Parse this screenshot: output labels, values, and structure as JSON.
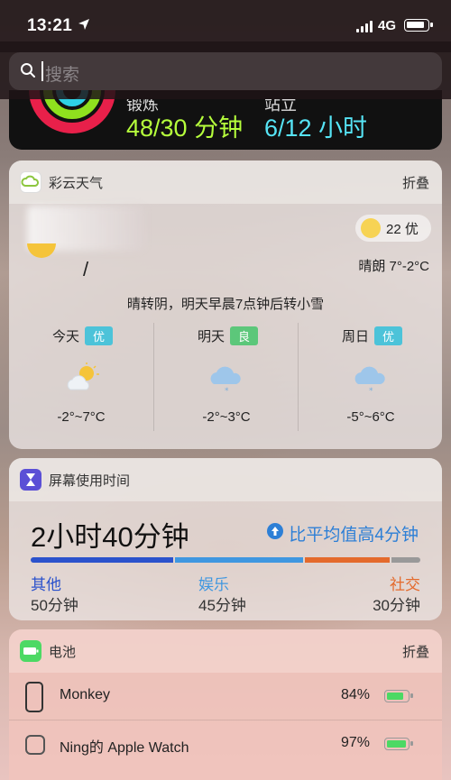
{
  "status_bar": {
    "time": "13:21",
    "network": "4G",
    "location_icon": "location-arrow-icon"
  },
  "search": {
    "placeholder": "搜索"
  },
  "activity": {
    "move_label": "锻炼",
    "move_value": "48/30 分钟",
    "stand_label": "站立",
    "stand_value": "6/12 小时",
    "colors": {
      "move": "#b6ff3c",
      "stand": "#56e4f5",
      "ring_outer": "#e8204a"
    }
  },
  "weather": {
    "app_name": "彩云天气",
    "fold_label": "折叠",
    "aqi": "22 优",
    "condition": "晴朗 7°-2°C",
    "summary": "晴转阴，明天早晨7点钟后转小雪",
    "current_temp_partial": "/",
    "days": [
      {
        "day": "今天",
        "quality": "优",
        "badge_color": "#4cc3d9",
        "icon": "sun-cloud-icon",
        "range": "-2°~7°C"
      },
      {
        "day": "明天",
        "quality": "良",
        "badge_color": "#5cc77a",
        "icon": "cloud-snow-icon",
        "range": "-2°~3°C"
      },
      {
        "day": "周日",
        "quality": "优",
        "badge_color": "#4cc3d9",
        "icon": "cloud-snow-icon",
        "range": "-5°~6°C"
      }
    ]
  },
  "screen_time": {
    "title": "屏幕使用时间",
    "total": "2小时40分钟",
    "comparison": "比平均值高4分钟",
    "categories": [
      {
        "name": "其他",
        "time": "50分钟",
        "color": "#2b52cc",
        "minutes": 50
      },
      {
        "name": "娱乐",
        "time": "45分钟",
        "color": "#3f97e0",
        "minutes": 45
      },
      {
        "name": "社交",
        "time": "30分钟",
        "color": "#e46a2c",
        "minutes": 30
      }
    ],
    "remainder_color": "#999999"
  },
  "battery": {
    "title": "电池",
    "fold_label": "折叠",
    "devices": [
      {
        "name": "Monkey",
        "percent": "84%",
        "level": 0.84,
        "icon": "iphone-icon"
      },
      {
        "name": "Ning的 Apple Watch",
        "percent": "97%",
        "level": 0.97,
        "icon": "apple-watch-icon"
      }
    ]
  }
}
